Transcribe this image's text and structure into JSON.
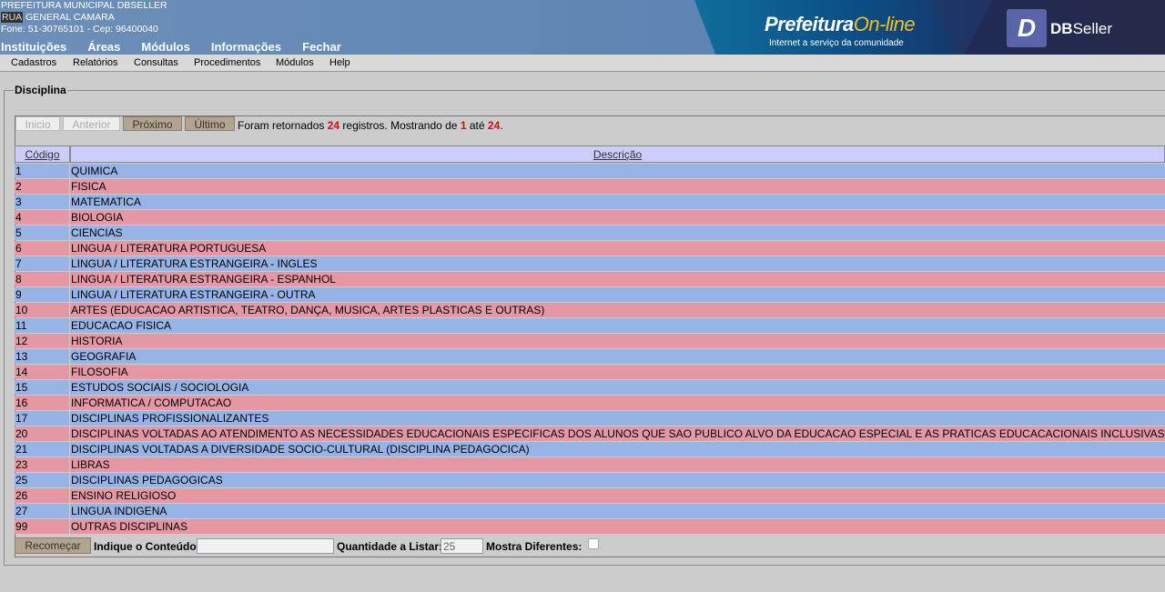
{
  "header": {
    "org_name": "PREFEITURA MUNICIPAL DBSELLER",
    "address_prefix": "RUA",
    "address_rest": "GENERAL CAMARA",
    "contact": "Fone: 51-30765101  -  Cep: 96400040",
    "nav": [
      "Instituições",
      "Áreas",
      "Módulos",
      "Informações",
      "Fechar"
    ]
  },
  "banner": {
    "logo_main": "Prefeitura",
    "logo_online": "On-line",
    "logo_sub": "Internet a serviço da comunidade",
    "dbs_mark": "D",
    "dbs_name_bold": "DB",
    "dbs_name_rest": "Seller"
  },
  "menubar": [
    "Cadastros",
    "Relatórios",
    "Consultas",
    "Procedimentos",
    "Módulos",
    "Help"
  ],
  "fieldset": {
    "legend": "Disciplina"
  },
  "pager": {
    "inicio": "Inicio",
    "anterior": "Anterior",
    "proximo": "Próximo",
    "ultimo": "Último",
    "info_prefix": "Foram retornados",
    "total": "24",
    "info_mid": "registros. Mostrando de",
    "from": "1",
    "info_ate": "até",
    "to": "24",
    "info_end": "."
  },
  "table": {
    "headers": {
      "codigo": "Código",
      "descricao": "Descrição"
    },
    "rows": [
      {
        "codigo": "1",
        "descricao": "QUIMICA"
      },
      {
        "codigo": "2",
        "descricao": "FISICA"
      },
      {
        "codigo": "3",
        "descricao": "MATEMATICA"
      },
      {
        "codigo": "4",
        "descricao": "BIOLOGIA"
      },
      {
        "codigo": "5",
        "descricao": "CIENCIAS"
      },
      {
        "codigo": "6",
        "descricao": "LINGUA / LITERATURA PORTUGUESA"
      },
      {
        "codigo": "7",
        "descricao": "LINGUA / LITERATURA ESTRANGEIRA - INGLES"
      },
      {
        "codigo": "8",
        "descricao": "LINGUA / LITERATURA ESTRANGEIRA - ESPANHOL"
      },
      {
        "codigo": "9",
        "descricao": "LINGUA / LITERATURA ESTRANGEIRA - OUTRA"
      },
      {
        "codigo": "10",
        "descricao": "ARTES (EDUCACAO ARTISTICA, TEATRO, DANÇA, MUSICA, ARTES PLASTICAS E OUTRAS)"
      },
      {
        "codigo": "11",
        "descricao": "EDUCACAO FISICA"
      },
      {
        "codigo": "12",
        "descricao": "HISTORIA"
      },
      {
        "codigo": "13",
        "descricao": "GEOGRAFIA"
      },
      {
        "codigo": "14",
        "descricao": "FILOSOFIA"
      },
      {
        "codigo": "15",
        "descricao": "ESTUDOS SOCIAIS / SOCIOLOGIA"
      },
      {
        "codigo": "16",
        "descricao": "INFORMATICA / COMPUTACAO"
      },
      {
        "codigo": "17",
        "descricao": "DISCIPLINAS PROFISSIONALIZANTES"
      },
      {
        "codigo": "20",
        "descricao": "DISCIPLINAS VOLTADAS AO ATENDIMENTO AS NECESSIDADES EDUCACIONAIS ESPECIFICAS DOS ALUNOS QUE SAO PUBLICO ALVO DA EDUCACAO ESPECIAL E AS PRATICAS EDUCACACIONAIS INCLUSIVAS"
      },
      {
        "codigo": "21",
        "descricao": "DISCIPLINAS VOLTADAS A DIVERSIDADE SOCIO-CULTURAL (DISCIPLINA PEDAGOCICA)"
      },
      {
        "codigo": "23",
        "descricao": "LIBRAS"
      },
      {
        "codigo": "25",
        "descricao": "DISCIPLINAS PEDAGOGICAS"
      },
      {
        "codigo": "26",
        "descricao": "ENSINO RELIGIOSO"
      },
      {
        "codigo": "27",
        "descricao": "LINGUA INDIGENA"
      },
      {
        "codigo": "99",
        "descricao": "OUTRAS DISCIPLINAS"
      }
    ]
  },
  "footer": {
    "recomecar": "Recomeçar",
    "conteudo_label": "Indique o Conteúdo:",
    "conteudo_value": "",
    "qtd_label": "Quantidade a Listar:",
    "qtd_value": "25",
    "dif_label": "Mostra Diferentes:"
  },
  "colors": {
    "row_odd": "#96b4e6",
    "row_even": "#e697a4",
    "header_bg": "#ccccff",
    "button_bg": "#b3a48f",
    "highlight_red": "#e00000"
  }
}
